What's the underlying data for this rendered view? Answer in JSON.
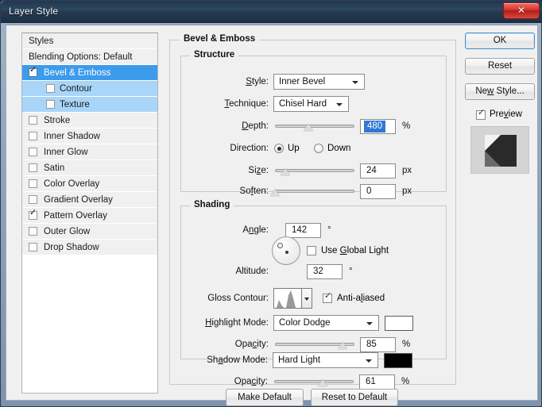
{
  "window": {
    "title": "Layer Style",
    "close_label": "✕"
  },
  "styles_panel": {
    "header": "Styles",
    "blending_options": "Blending Options: Default",
    "items": [
      {
        "label": "Bevel & Emboss",
        "checked": true,
        "selected": true,
        "sub": false
      },
      {
        "label": "Contour",
        "checked": false,
        "selected": false,
        "sub": true
      },
      {
        "label": "Texture",
        "checked": false,
        "selected": false,
        "sub": true
      },
      {
        "label": "Stroke",
        "checked": false,
        "selected": false,
        "sub": false
      },
      {
        "label": "Inner Shadow",
        "checked": false,
        "selected": false,
        "sub": false
      },
      {
        "label": "Inner Glow",
        "checked": false,
        "selected": false,
        "sub": false
      },
      {
        "label": "Satin",
        "checked": false,
        "selected": false,
        "sub": false
      },
      {
        "label": "Color Overlay",
        "checked": false,
        "selected": false,
        "sub": false
      },
      {
        "label": "Gradient Overlay",
        "checked": false,
        "selected": false,
        "sub": false
      },
      {
        "label": "Pattern Overlay",
        "checked": true,
        "selected": false,
        "sub": false
      },
      {
        "label": "Outer Glow",
        "checked": false,
        "selected": false,
        "sub": false
      },
      {
        "label": "Drop Shadow",
        "checked": false,
        "selected": false,
        "sub": false
      }
    ]
  },
  "right_panel": {
    "ok": "OK",
    "reset": "Reset",
    "new_style": "New Style...",
    "preview_label": "Preview",
    "preview_checked": true
  },
  "main": {
    "group_title": "Bevel & Emboss",
    "structure": {
      "title": "Structure",
      "style_label": "Style:",
      "style_value": "Inner Bevel",
      "technique_label": "Technique:",
      "technique_value": "Chisel Hard",
      "depth_label": "Depth:",
      "depth_value": "480",
      "depth_unit": "%",
      "depth_percent": 42,
      "direction_label": "Direction:",
      "direction_up": "Up",
      "direction_down": "Down",
      "direction_selected": "Up",
      "size_label": "Size:",
      "size_value": "24",
      "size_unit": "px",
      "size_percent": 13,
      "soften_label": "Soften:",
      "soften_value": "0",
      "soften_unit": "px",
      "soften_percent": 0
    },
    "shading": {
      "title": "Shading",
      "angle_label": "Angle:",
      "angle_value": "142",
      "angle_unit": "°",
      "use_global_light": "Use Global Light",
      "use_global_light_checked": false,
      "altitude_label": "Altitude:",
      "altitude_value": "32",
      "altitude_unit": "°",
      "gloss_contour_label": "Gloss Contour:",
      "anti_aliased": "Anti-aliased",
      "anti_aliased_checked": true,
      "highlight_mode_label": "Highlight Mode:",
      "highlight_mode_value": "Color Dodge",
      "highlight_color": "#ffffff",
      "highlight_opacity_label": "Opacity:",
      "highlight_opacity_value": "85",
      "highlight_opacity_unit": "%",
      "highlight_opacity_percent": 85,
      "shadow_mode_label": "Shadow Mode:",
      "shadow_mode_value": "Hard Light",
      "shadow_color": "#000000",
      "shadow_opacity_label": "Opacity:",
      "shadow_opacity_value": "61",
      "shadow_opacity_unit": "%",
      "shadow_opacity_percent": 61
    },
    "make_default": "Make Default",
    "reset_to_default": "Reset to Default"
  }
}
